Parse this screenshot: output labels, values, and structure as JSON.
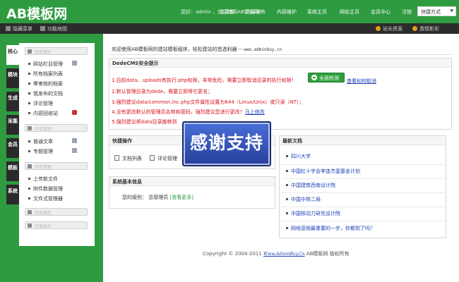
{
  "app": {
    "logo": "AB模板网"
  },
  "header": {
    "greeting": "您好：admin ，欢迎使用AB模板网！",
    "nav": [
      "主菜单",
      "内容发布",
      "内容维护",
      "系统主页",
      "网站主页",
      "会员中心",
      "注销"
    ],
    "quick_menu": "快捷方式"
  },
  "subbar": {
    "left": [
      "隐藏菜单",
      "功能地图"
    ],
    "right": [
      "站长资源",
      "激情影彩"
    ]
  },
  "vtabs": [
    "核心",
    "模块",
    "生成",
    "采集",
    "会员",
    "模板",
    "系统"
  ],
  "menu": {
    "groups": [
      {
        "title": "常用操作",
        "items": [
          "网站栏目管理",
          "所有档案列表",
          "等审核的档案",
          "我发布的文档",
          "评论管理",
          "内容回收站"
        ]
      },
      {
        "title": "内容管理",
        "items": [
          "普通文章",
          "专题管理"
        ]
      },
      {
        "title": "附件管理",
        "items": [
          "上传新文件",
          "附件数据管理",
          "文件式管理器"
        ]
      },
      {
        "title": "频道模型",
        "items": []
      },
      {
        "title": "批量维护",
        "items": []
      }
    ]
  },
  "main": {
    "welcome_text": "欢迎使用AB模板网的建站模板程序，轻松建站的首选利器 -- ",
    "welcome_url": "www.adminbuy.cn",
    "security": {
      "title": "DedeCMS安全提示",
      "warnings": [
        "1.目前data、uploads有执行.php权限，非常危险，需要立即取消目录的执行权限！",
        "2.默认管理目录为dede，需要立即将它更名；",
        "3.强烈建议data/common.inc.php文件属性设置为644（Linux/Unix）或只读（NT）；",
        "4.没有更改默认的管理员名称和密码，强烈建议您进行更改！",
        "5.强烈建议将data目录搬移到"
      ],
      "warning4_link": "马上修改",
      "check_button": "全面检测",
      "how_link": "查看如何取消"
    },
    "quick_ops": {
      "title": "快捷操作",
      "links": [
        "文档列表",
        "评论管理"
      ]
    },
    "sys_info": {
      "title": "系统基本信息",
      "level_label": "您的级别：",
      "level_value": "总管理员",
      "more_link": "[查看更多]"
    },
    "news": {
      "title": "最新文档",
      "items": [
        "四川大学",
        "中国红十字会李连杰壹基金计划",
        "中国建筑西南设计院",
        "中国中铁二局",
        "中国核动力研究设计院",
        "网络营销最重要的一步，你都到了吗？"
      ]
    },
    "footer": {
      "text_before": "Copyright © 2004-2011 ",
      "link": "Www.AdminBuy.Cn",
      "text_after": " AB模板网 版权所有"
    }
  },
  "overlay": {
    "text": "感谢支持"
  },
  "colors": {
    "brand_green": "#2e9b40",
    "dark_bar": "#2c2c2c",
    "warning_red": "#d8101a",
    "link_blue": "#1a3fb5"
  }
}
